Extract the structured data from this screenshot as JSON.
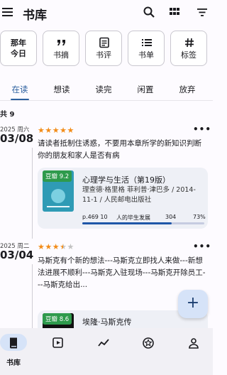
{
  "header": {
    "title": "书库",
    "icons": [
      "menu-icon",
      "search-icon",
      "grid-icon",
      "filter-icon"
    ]
  },
  "shortcuts": [
    {
      "label": "那年今日",
      "icon": ""
    },
    {
      "label": "书摘",
      "icon": "quote-icon"
    },
    {
      "label": "书评",
      "icon": "review-icon"
    },
    {
      "label": "书单",
      "icon": "list-icon"
    },
    {
      "label": "标签",
      "icon": "hashtag-icon"
    }
  ],
  "tabs": [
    {
      "label": "在读",
      "active": true
    },
    {
      "label": "想读",
      "active": false
    },
    {
      "label": "读完",
      "active": false
    },
    {
      "label": "闲置",
      "active": false
    },
    {
      "label": "放弃",
      "active": false
    }
  ],
  "count": "共 9",
  "entries": [
    {
      "year_week": "2025 周六",
      "date": "03/08",
      "rating": 5,
      "note": "请读者抵制住诱惑，不要用本章所学的新知识判断你的朋友和家人是否有病",
      "book": {
        "badge": "豆瓣 9.2",
        "title": "心理学与生活（第19版）",
        "authors": "理查德·格里格  菲利普·津巴多 / 2014-11-1 / 人民邮电出版社",
        "page": "p.469 10",
        "chapter": "人的毕生发展",
        "page_total": "304",
        "percent_label": "73%",
        "progress": 0.73
      }
    },
    {
      "year_week": "2025 周二",
      "date": "03/04",
      "rating": 3.5,
      "note": "马斯克有个新的想法---马斯克立即找人来做---新想法进展不顺利---马斯克入驻现场---马斯克开除员工---马斯克给出...",
      "book": {
        "badge": "豆瓣 8.6",
        "title": "埃隆·马斯克传"
      }
    }
  ],
  "fab": {
    "label": "+"
  },
  "bottom_nav": [
    {
      "label": "书库",
      "icon": "book-icon",
      "active": true
    },
    {
      "label": "",
      "icon": "video-icon",
      "active": false
    },
    {
      "label": "",
      "icon": "stats-icon",
      "active": false
    },
    {
      "label": "",
      "icon": "star-badge-icon",
      "active": false
    },
    {
      "label": "",
      "icon": "person-icon",
      "active": false
    }
  ],
  "colors": {
    "accent": "#2b5f9e",
    "star": "#f28c18",
    "badge_green": "#2e9a4c",
    "progress": "#1f56a8"
  }
}
